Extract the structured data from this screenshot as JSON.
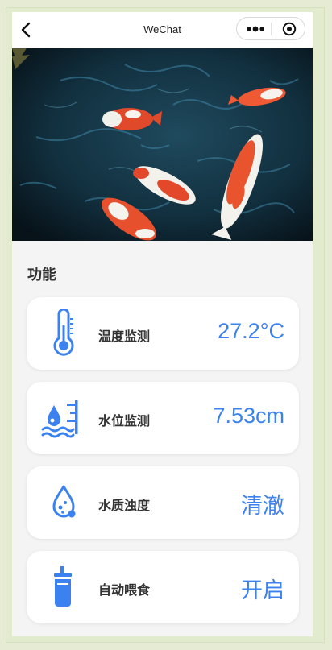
{
  "navbar": {
    "title": "WeChat"
  },
  "section": {
    "title": "功能"
  },
  "cards": [
    {
      "label": "温度监测",
      "value": "27.2°C",
      "icon": "thermometer-icon"
    },
    {
      "label": "水位监测",
      "value": "7.53cm",
      "icon": "water-level-icon"
    },
    {
      "label": "水质浊度",
      "value": "清澈",
      "icon": "water-drop-icon"
    },
    {
      "label": "自动喂食",
      "value": "开启",
      "icon": "feeder-cup-icon"
    }
  ],
  "colors": {
    "accent": "#3b82f0",
    "background": "#f4f4f4"
  }
}
